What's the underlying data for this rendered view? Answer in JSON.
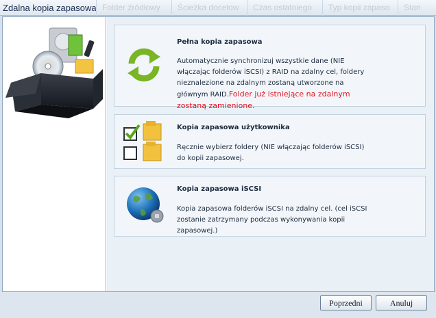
{
  "window": {
    "title": "Zdalna kopia zapasowa",
    "ghost_columns": [
      "Folder źródłowy",
      "Ścieżka docelow",
      "Czas ostatniego",
      "Typ kopii zapaso",
      "Stan"
    ]
  },
  "options": [
    {
      "title": "Pełna kopia zapasowa",
      "description": "Automatycznie synchronizuj wszystkie dane (NIE włączając folderów iSCSI) z RAID na zdalny cel, foldery nieznalezione na zdalnym zostaną utworzone na głównym RAID.",
      "warning": "Folder już istniejące na zdalnym zostaną zamienione."
    },
    {
      "title": "Kopia zapasowa użytkownika",
      "description": "Ręcznie wybierz foldery (NIE włączając folderów iSCSI) do kopii zapasowej."
    },
    {
      "title": "Kopia zapasowa iSCSI",
      "description": "Kopia zapasowa folderów iSCSI na zdalny cel. (cel iSCSI zostanie zatrzymany podczas wykonywania kopii zapasowej.)"
    }
  ],
  "buttons": {
    "previous": "Poprzedni",
    "cancel": "Anuluj"
  },
  "colors": {
    "warning": "#e0141e",
    "sync_arrows": "#7ab526",
    "globe": "#1d6fb8"
  },
  "icons": [
    "backup-box-icon",
    "sync-arrows-icon",
    "folder-checkbox-icon",
    "globe-network-icon"
  ]
}
